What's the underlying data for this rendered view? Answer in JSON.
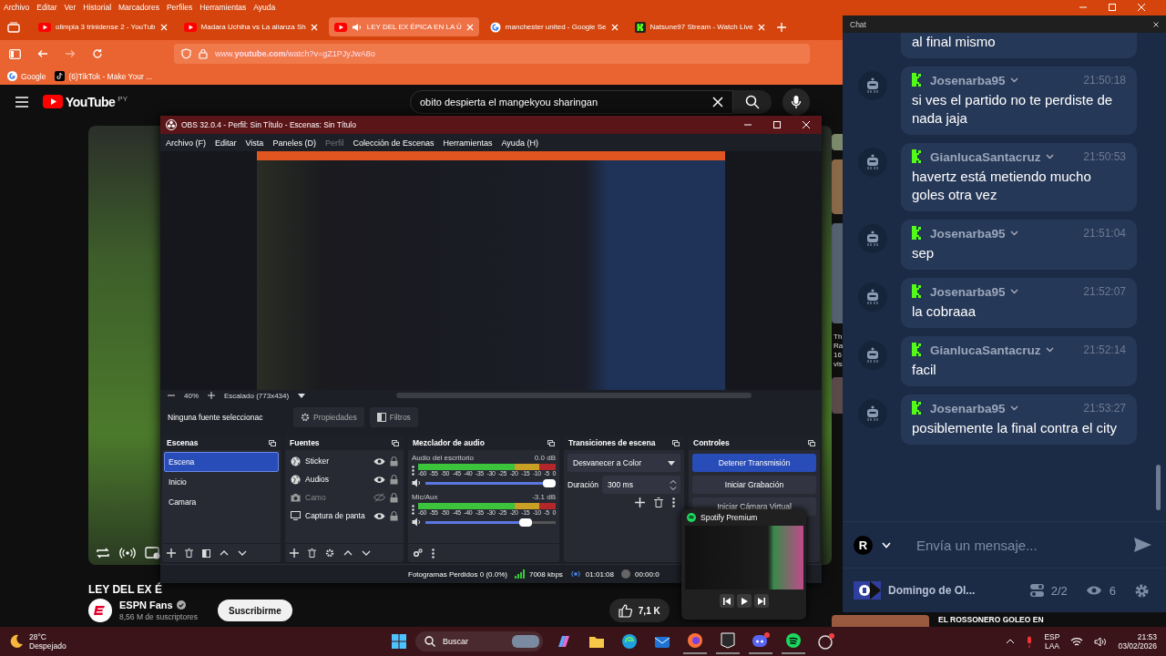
{
  "browser": {
    "menu": [
      "Archivo",
      "Editar",
      "Ver",
      "Historial",
      "Marcadores",
      "Perfiles",
      "Herramientas",
      "Ayuda"
    ],
    "tabs": [
      {
        "title": "olimpia 3 trinidense 2 - YouTub",
        "kind": "youtube",
        "selected": false,
        "audio": false
      },
      {
        "title": "Madara Uchiha vs La alianza Sh",
        "kind": "youtube",
        "selected": false,
        "audio": false
      },
      {
        "title": "LEY DEL EX ÉPICA EN LA Ú",
        "kind": "youtube",
        "selected": true,
        "audio": true
      },
      {
        "title": "manchester united - Google Se",
        "kind": "google",
        "selected": false,
        "audio": false
      },
      {
        "title": "Natsune97 Stream - Watch Live",
        "kind": "kick",
        "selected": false,
        "audio": false
      }
    ],
    "url": "www.**youtube.com**/watch?v=gZ1PJyJwA8o",
    "bookmarks": [
      {
        "label": "Google",
        "kind": "google"
      },
      {
        "label": "(6)TikTok - Make Your ...",
        "kind": "tiktok"
      }
    ]
  },
  "youtube": {
    "logo": "YouTube",
    "logo_badge": "PY",
    "search": {
      "value": "obito despierta el mangekyou sharingan"
    },
    "video_title": "LEY DEL EX É",
    "channel": {
      "name": "ESPN Fans",
      "verified": true,
      "subscribers": "8,56 M de suscriptores"
    },
    "subscribe": "Suscribirme",
    "likes": "7,1 K",
    "side_texts": [
      "Th",
      "Ra",
      "16",
      "vis"
    ],
    "recommendation": "EL ROSSONERO GOLEO EN"
  },
  "obs": {
    "title": "OBS 32.0.4 - Perfil: Sin Título - Escenas: Sin Título",
    "menu": [
      {
        "label": "Archivo (F)",
        "disabled": false
      },
      {
        "label": "Editar",
        "disabled": false
      },
      {
        "label": "Vista",
        "disabled": false
      },
      {
        "label": "Paneles (D)",
        "disabled": false
      },
      {
        "label": "Perfil",
        "disabled": true
      },
      {
        "label": "Colección de Escenas",
        "disabled": false
      },
      {
        "label": "Herramientas",
        "disabled": false
      },
      {
        "label": "Ayuda (H)",
        "disabled": false
      }
    ],
    "zoom": "40%",
    "scaling": "Escalado (773x434)",
    "no_source": "Ninguna fuente seleccionac",
    "properties": "Propiedades",
    "filters": "Filtros",
    "docks": {
      "scenes": "Escenas",
      "sources": "Fuentes",
      "mixer": "Mezclador de audio",
      "transitions": "Transiciones de escena",
      "controls": "Controles"
    },
    "scenes": [
      {
        "name": "Escena",
        "selected": true
      },
      {
        "name": "Inicio",
        "selected": false
      },
      {
        "name": "Camara",
        "selected": false
      }
    ],
    "sources": [
      {
        "name": "Sticker",
        "kind": "browser",
        "visible": true
      },
      {
        "name": "Audios",
        "kind": "browser",
        "visible": true
      },
      {
        "name": "Camo",
        "kind": "camera",
        "visible": false
      },
      {
        "name": "Captura de panta",
        "kind": "display",
        "visible": true
      }
    ],
    "channels": [
      {
        "name": "Audio del escritorio",
        "reading": "0.0 dB",
        "level": 1.0,
        "scale": [
          "-60",
          "-55",
          "-50",
          "-45",
          "-40",
          "-35",
          "-30",
          "-25",
          "-20",
          "-15",
          "-10",
          "-5",
          "0"
        ]
      },
      {
        "name": "Mic/Aux",
        "reading": "-3.1 dB",
        "level": 0.82,
        "scale": [
          "-60",
          "-55",
          "-50",
          "-45",
          "-40",
          "-35",
          "-30",
          "-25",
          "-20",
          "-15",
          "-10",
          "-5",
          "0"
        ]
      }
    ],
    "transition": {
      "value": "Desvanecer a Color",
      "duration_label": "Duración",
      "duration": "300 ms"
    },
    "controls": [
      {
        "label": "Detener Transmisión",
        "active": true
      },
      {
        "label": "Iniciar Grabación",
        "active": false
      },
      {
        "label": "Iniciar Cámara Virtual",
        "active": false
      }
    ],
    "status": {
      "dropped": "Fotogramas Perdidos 0 (0.0%)",
      "bitrate": "7008 kbps",
      "stream_time": "01:01:08",
      "record_time": "00:00:0"
    }
  },
  "spotify": {
    "title": "Spotify Premium"
  },
  "chat": {
    "title": "Chat",
    "partial": "al final mismo",
    "messages": [
      {
        "user": "Josenarba95",
        "time": "21:50:18",
        "text": "si ves el partido no te perdiste de nada jaja"
      },
      {
        "user": "GianlucaSantacruz",
        "time": "21:50:53",
        "text": "havertz está metiendo mucho goles otra vez"
      },
      {
        "user": "Josenarba95",
        "time": "21:51:04",
        "text": "sep"
      },
      {
        "user": "Josenarba95",
        "time": "21:52:07",
        "text": "la cobraaa"
      },
      {
        "user": "GianlucaSantacruz",
        "time": "21:52:14",
        "text": "facil"
      },
      {
        "user": "Josenarba95",
        "time": "21:53:27",
        "text": "posiblemente la final contra el city"
      }
    ],
    "avatar_letter": "R",
    "placeholder": "Envía un mensaje...",
    "channel": "Domingo de Ol...",
    "streams": "2/2",
    "viewers": "6"
  },
  "taskbar": {
    "temp": "28°C",
    "weather": "Despejado",
    "search": "Buscar",
    "apps": [
      {
        "kind": "copilot",
        "running": false
      },
      {
        "kind": "folder",
        "running": false
      },
      {
        "kind": "edge",
        "running": false
      },
      {
        "kind": "mail",
        "running": false
      },
      {
        "kind": "firefox",
        "running": true
      },
      {
        "kind": "epic",
        "running": true
      },
      {
        "kind": "discord",
        "running": true
      },
      {
        "kind": "spotify",
        "running": true
      },
      {
        "kind": "app",
        "running": false
      }
    ],
    "lang": "ESP",
    "layout": "LAA",
    "time": "21:53",
    "date": "03/02/2026"
  }
}
